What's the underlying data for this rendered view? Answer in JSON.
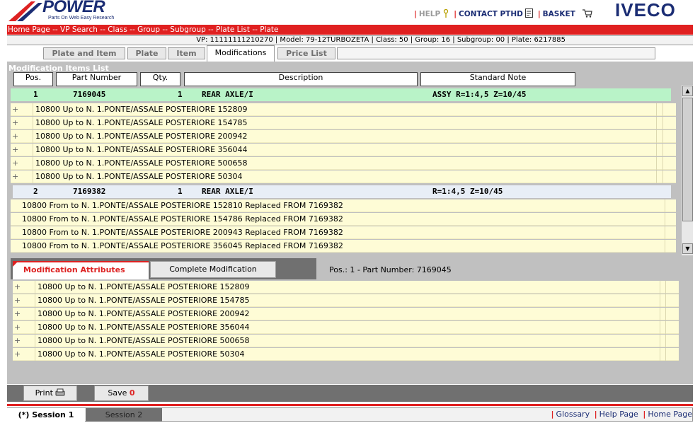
{
  "header": {
    "brand": "POWER",
    "brand_tagline": "Parts On Web Easy Research",
    "help": "HELP",
    "contact": "CONTACT PTHD",
    "basket": "BASKET",
    "iveco": "IVECO"
  },
  "breadcrumb": "Home Page -- VP Search -- Class -- Group -- Subgroup -- Plate List -- Plate",
  "info_line": "VP: 11111111210270 | Model: 79-12TURBOZETA | Class: 50 | Group: 16 | Subgroup: 00 | Plate: 6217885",
  "tabs": [
    "Plate and Item",
    "Plate",
    "Item",
    "Modifications",
    "Price List"
  ],
  "list": {
    "title": "Modification Items List",
    "columns": [
      "Pos.",
      "Part Number",
      "Qty.",
      "Description",
      "Standard Note"
    ],
    "items": [
      {
        "pos": "1",
        "part_number": "7169045",
        "qty": "1",
        "description": "REAR AXLE/I",
        "note": "ASSY R=1:4,5 Z=10/45",
        "mods": [
          "10800 Up to N. 1.PONTE/ASSALE POSTERIORE  152809",
          "10800 Up to N. 1.PONTE/ASSALE POSTERIORE  154785",
          "10800 Up to N. 1.PONTE/ASSALE POSTERIORE  200942",
          "10800 Up to N. 1.PONTE/ASSALE POSTERIORE  356044",
          "10800 Up to N. 1.PONTE/ASSALE POSTERIORE  500658",
          "10800 Up to N. 1.PONTE/ASSALE POSTERIORE  50304"
        ]
      },
      {
        "pos": "2",
        "part_number": "7169382",
        "qty": "1",
        "description": "REAR AXLE/I",
        "note": "R=1:4,5 Z=10/45",
        "mods": [
          "10800 From to N. 1.PONTE/ASSALE POSTERIORE 152810 Replaced FROM 7169382",
          "10800 From to N. 1.PONTE/ASSALE POSTERIORE 154786 Replaced FROM 7169382",
          "10800 From to N. 1.PONTE/ASSALE POSTERIORE 200943 Replaced FROM 7169382",
          "10800 From to N. 1.PONTE/ASSALE POSTERIORE 356045 Replaced FROM 7169382"
        ]
      }
    ]
  },
  "lower": {
    "tab_attributes": "Modification Attributes",
    "tab_complete": "Complete Modification",
    "pos_info": "Pos.:  1 - Part Number:  7169045",
    "attributes": [
      "10800 Up to N. 1.PONTE/ASSALE POSTERIORE  152809",
      "10800 Up to N. 1.PONTE/ASSALE POSTERIORE  154785",
      "10800 Up to N. 1.PONTE/ASSALE POSTERIORE  200942",
      "10800 Up to N. 1.PONTE/ASSALE POSTERIORE  356044",
      "10800 Up to N. 1.PONTE/ASSALE POSTERIORE  500658",
      "10800 Up to N. 1.PONTE/ASSALE POSTERIORE  50304"
    ]
  },
  "toolbar": {
    "print": "Print",
    "save": "Save",
    "save_count": "0"
  },
  "footer": {
    "session1": "(*) Session 1",
    "session2": "Session 2",
    "links": [
      "Glossary",
      "Help Page",
      "Home Page"
    ]
  },
  "colors": {
    "accent_red": "#e02020",
    "brand_blue": "#1b2d74",
    "row_yellow": "#fefcd6",
    "row_green": "#b9f3c8"
  }
}
